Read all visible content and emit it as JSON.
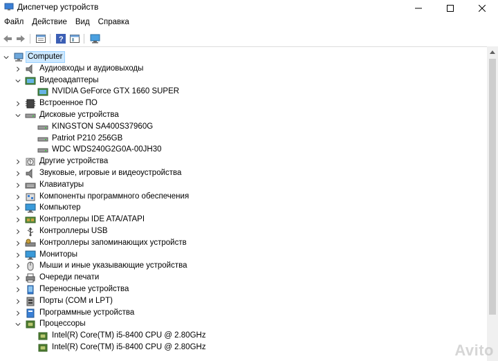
{
  "window": {
    "title": "Диспетчер устройств"
  },
  "menu": [
    "Файл",
    "Действие",
    "Вид",
    "Справка"
  ],
  "tree": [
    {
      "label": "Computer",
      "level": 0,
      "expanded": true,
      "icon": "computer-icon",
      "selected": true
    },
    {
      "label": "Аудиовходы и аудиовыходы",
      "level": 1,
      "expanded": false,
      "icon": "speaker-icon"
    },
    {
      "label": "Видеоадаптеры",
      "level": 1,
      "expanded": true,
      "icon": "display-adapter-icon"
    },
    {
      "label": "NVIDIA GeForce GTX 1660 SUPER",
      "level": 2,
      "icon": "display-adapter-icon"
    },
    {
      "label": "Встроенное ПО",
      "level": 1,
      "expanded": false,
      "icon": "firmware-icon"
    },
    {
      "label": "Дисковые устройства",
      "level": 1,
      "expanded": true,
      "icon": "disk-drive-icon"
    },
    {
      "label": "KINGSTON SA400S37960G",
      "level": 2,
      "icon": "disk-drive-icon"
    },
    {
      "label": "Patriot P210 256GB",
      "level": 2,
      "icon": "disk-drive-icon"
    },
    {
      "label": "WDC WDS240G2G0A-00JH30",
      "level": 2,
      "icon": "disk-drive-icon"
    },
    {
      "label": "Другие устройства",
      "level": 1,
      "expanded": false,
      "icon": "unknown-device-icon"
    },
    {
      "label": "Звуковые, игровые и видеоустройства",
      "level": 1,
      "expanded": false,
      "icon": "speaker-icon"
    },
    {
      "label": "Клавиатуры",
      "level": 1,
      "expanded": false,
      "icon": "keyboard-icon"
    },
    {
      "label": "Компоненты программного обеспечения",
      "level": 1,
      "expanded": false,
      "icon": "software-component-icon"
    },
    {
      "label": "Компьютер",
      "level": 1,
      "expanded": false,
      "icon": "monitor-icon"
    },
    {
      "label": "Контроллеры IDE ATA/ATAPI",
      "level": 1,
      "expanded": false,
      "icon": "ide-controller-icon"
    },
    {
      "label": "Контроллеры USB",
      "level": 1,
      "expanded": false,
      "icon": "usb-icon"
    },
    {
      "label": "Контроллеры запоминающих устройств",
      "level": 1,
      "expanded": false,
      "icon": "storage-controller-icon"
    },
    {
      "label": "Мониторы",
      "level": 1,
      "expanded": false,
      "icon": "monitor-icon"
    },
    {
      "label": "Мыши и иные указывающие устройства",
      "level": 1,
      "expanded": false,
      "icon": "mouse-icon"
    },
    {
      "label": "Очереди печати",
      "level": 1,
      "expanded": false,
      "icon": "printer-icon"
    },
    {
      "label": "Переносные устройства",
      "level": 1,
      "expanded": false,
      "icon": "portable-device-icon"
    },
    {
      "label": "Порты (COM и LPT)",
      "level": 1,
      "expanded": false,
      "icon": "port-icon"
    },
    {
      "label": "Программные устройства",
      "level": 1,
      "expanded": false,
      "icon": "software-device-icon"
    },
    {
      "label": "Процессоры",
      "level": 1,
      "expanded": true,
      "icon": "processor-icon"
    },
    {
      "label": "Intel(R) Core(TM) i5-8400 CPU @ 2.80GHz",
      "level": 2,
      "icon": "processor-icon"
    },
    {
      "label": "Intel(R) Core(TM) i5-8400 CPU @ 2.80GHz",
      "level": 2,
      "icon": "processor-icon"
    }
  ],
  "watermark": "Avito"
}
